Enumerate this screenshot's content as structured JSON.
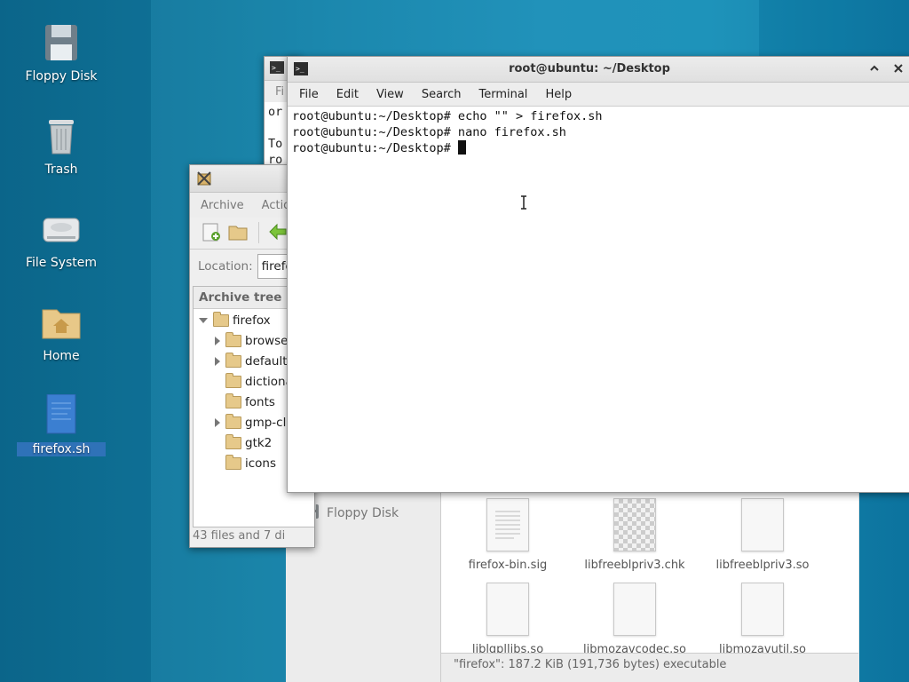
{
  "desktop": {
    "icons": [
      {
        "label": "Floppy Disk"
      },
      {
        "label": "Trash"
      },
      {
        "label": "File System"
      },
      {
        "label": "Home"
      },
      {
        "label": "firefox.sh"
      }
    ]
  },
  "back_window": {
    "menu_partial": "Fi",
    "lines": [
      "or",
      "S",
      "To",
      "ro"
    ]
  },
  "terminal": {
    "title": "root@ubuntu: ~/Desktop",
    "menu": [
      "File",
      "Edit",
      "View",
      "Search",
      "Terminal",
      "Help"
    ],
    "lines": [
      "root@ubuntu:~/Desktop# echo \"\" > firefox.sh",
      "root@ubuntu:~/Desktop# nano firefox.sh",
      "root@ubuntu:~/Desktop# "
    ]
  },
  "archive_manager": {
    "menu": [
      "Archive",
      "Actio"
    ],
    "location_label": "Location:",
    "location_value": "firefo",
    "panel_header": "Archive tree",
    "tree": [
      {
        "label": "firefox",
        "expander": "open"
      },
      {
        "label": "browse",
        "expander": "closed"
      },
      {
        "label": "default",
        "expander": "closed"
      },
      {
        "label": "dictiona",
        "expander": "none"
      },
      {
        "label": "fonts",
        "expander": "none"
      },
      {
        "label": "gmp-cl",
        "expander": "closed"
      },
      {
        "label": "gtk2",
        "expander": "none"
      },
      {
        "label": "icons",
        "expander": "none"
      }
    ],
    "status": "43 files and 7 di"
  },
  "file_manager": {
    "sidebar_item": "Floppy Disk",
    "files": [
      {
        "name": "firefox-bin.sig"
      },
      {
        "name": "libfreeblpriv3.chk"
      },
      {
        "name": "libfreeblpriv3.so"
      },
      {
        "name": "liblgpllibs.so"
      },
      {
        "name": "libmozavcodec.so"
      },
      {
        "name": "libmozavutil.so"
      }
    ],
    "status": "\"firefox\": 187.2 KiB (191,736 bytes) executable"
  }
}
